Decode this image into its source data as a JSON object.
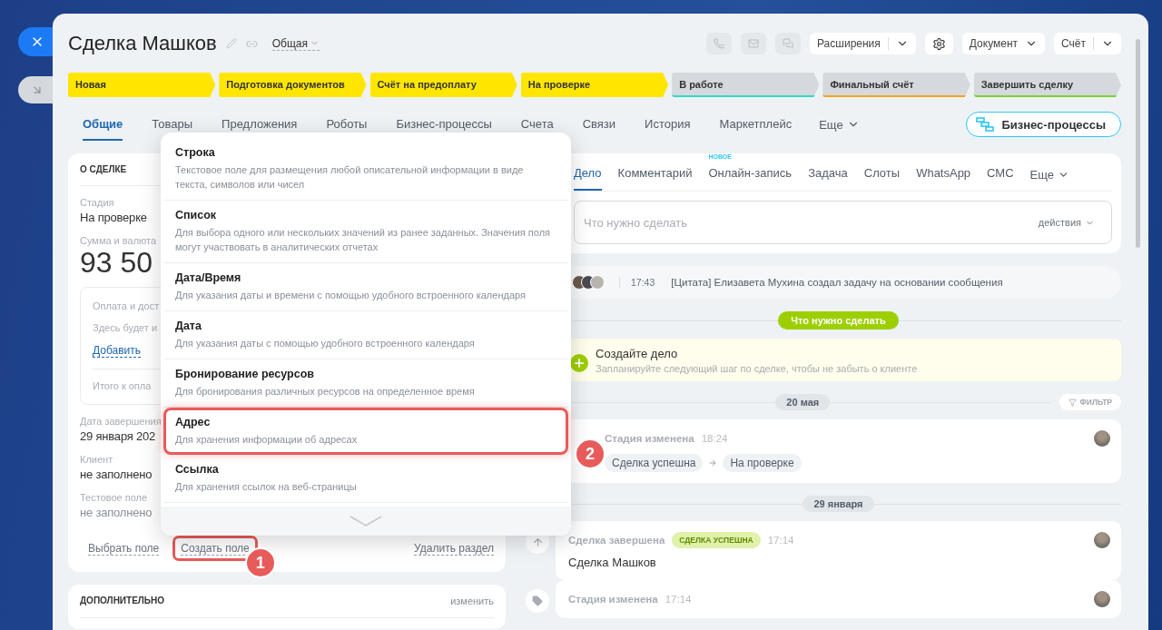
{
  "header": {
    "title": "Сделка Машков",
    "category": "Общая",
    "buttons": [
      {
        "kind": "split",
        "label": "Расширения"
      },
      {
        "kind": "gear"
      },
      {
        "kind": "dropdown",
        "label": "Документ"
      },
      {
        "kind": "split",
        "label": "Счёт"
      }
    ]
  },
  "stages": [
    {
      "label": "Новая",
      "reached": true,
      "color": "#ffe600"
    },
    {
      "label": "Подготовка документов",
      "reached": true,
      "color": "#ffe600"
    },
    {
      "label": "Счёт на предоплату",
      "reached": true,
      "color": "#ffe600"
    },
    {
      "label": "На проверке",
      "reached": true,
      "color": "#ffe600"
    },
    {
      "label": "В работе",
      "reached": false,
      "color": "#2fd9c7"
    },
    {
      "label": "Финальный счёт",
      "reached": false,
      "color": "#f7a21b"
    },
    {
      "label": "Завершить сделку",
      "reached": false,
      "color": "#7bd134"
    }
  ],
  "tabs": [
    {
      "label": "Общие",
      "selected": true
    },
    {
      "label": "Товары",
      "selected": false
    },
    {
      "label": "Предложения",
      "selected": false
    },
    {
      "label": "Роботы",
      "selected": false
    },
    {
      "label": "Бизнес-процессы",
      "selected": false
    },
    {
      "label": "Счета",
      "selected": false
    },
    {
      "label": "Связи",
      "selected": false
    },
    {
      "label": "История",
      "selected": false
    },
    {
      "label": "Маркетплейс",
      "selected": false
    }
  ],
  "tabs_more": "Еще",
  "bp_button": "Бизнес-процессы",
  "about": {
    "title": "О СДЕЛКЕ",
    "fields": [
      {
        "kind": "field",
        "label": "Стадия",
        "value": "На проверке",
        "empty": false
      },
      {
        "kind": "amount",
        "label": "Сумма и валюта",
        "value": "93 50"
      },
      {
        "kind": "payment",
        "label": "Оплата и дост",
        "hint": "Здесь будет и",
        "link": "Добавить",
        "total": "Итого к опла"
      },
      {
        "kind": "field",
        "label": "Дата завершения",
        "value": "29 января 202",
        "empty": false
      },
      {
        "kind": "field",
        "label": "Клиент",
        "value": "не заполнено",
        "empty": false
      },
      {
        "kind": "field",
        "label": "Тестовое поле",
        "value": "не заполнено",
        "empty": true
      }
    ],
    "actions": [
      {
        "label": "Выбрать поле",
        "highlighted": false
      },
      {
        "label": "Создать поле",
        "highlighted": true,
        "callout": "1"
      }
    ],
    "remove": "Удалить раздел"
  },
  "extra": {
    "title": "ДОПОЛНИТЕЛЬНО",
    "edit": "изменить"
  },
  "menu": {
    "items": [
      {
        "title": "Строка",
        "description": "Текстовое поле для размещения любой описательной информации в виде текста, символов или чисел",
        "selected": false
      },
      {
        "title": "Список",
        "description": "Для выбора одного или нескольких значений из ранее заданных. Значения поля могут участвовать в аналитических отчетах",
        "selected": false
      },
      {
        "title": "Дата/Время",
        "description": "Для указания даты и времени с помощью удобного встроенного календаря",
        "selected": false
      },
      {
        "title": "Дата",
        "description": "Для указания даты с помощью удобного встроенного календаря",
        "selected": false
      },
      {
        "title": "Бронирование ресурсов",
        "description": "Для бронирования различных ресурсов на определенное время",
        "selected": false
      },
      {
        "title": "Адрес",
        "description": "Для хранения информации об адресах",
        "selected": true,
        "callout": "2"
      },
      {
        "title": "Ссылка",
        "description": "Для хранения ссылок на веб-страницы",
        "selected": false
      }
    ]
  },
  "activity": {
    "tabs": [
      {
        "label": "Дело",
        "selected": true
      },
      {
        "label": "Комментарий",
        "selected": false
      },
      {
        "label": "Онлайн-запись",
        "selected": false,
        "badge": "НОВОЕ"
      },
      {
        "label": "Задача",
        "selected": false
      },
      {
        "label": "Слоты",
        "selected": false
      },
      {
        "label": "WhatsApp",
        "selected": false
      },
      {
        "label": "СМС",
        "selected": false
      }
    ],
    "more": "Еще",
    "input": {
      "placeholder": "Что нужно сделать"
    },
    "actions": "действия"
  },
  "pinned": {
    "time": "17:43",
    "text": "[Цитата] Елизавета Мухина создал задачу на основании сообщения"
  },
  "todo": {
    "label": "Что нужно сделать",
    "title": "Создайте дело",
    "hint": "Запланируйте следующий шаг по сделке, чтобы не забыть о клиенте"
  },
  "timeline": [
    {
      "kind": "date",
      "label": "20 мая",
      "filter": "ФИЛЬТР"
    },
    {
      "kind": "stage",
      "title": "Стадия изменена",
      "time": "18:24",
      "from": "Сделка успешна",
      "to": "На проверке"
    },
    {
      "kind": "date",
      "label": "29 января"
    },
    {
      "kind": "closed",
      "title": "Сделка завершена",
      "badge": "СДЕЛКА УСПЕШНА",
      "time": "17:14",
      "text": "Сделка Машков"
    },
    {
      "kind": "stage",
      "title": "Стадия изменена",
      "time": "17:14"
    }
  ]
}
